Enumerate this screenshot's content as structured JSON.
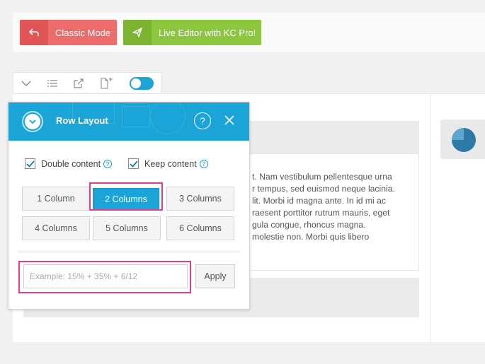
{
  "topbar": {
    "classic_mode_label": "Classic Mode",
    "live_editor_label": "Live Editor with KC Pro!"
  },
  "toolbar": {
    "icons": [
      "chevron-down-icon",
      "list-icon",
      "export-icon",
      "add-page-icon"
    ],
    "toggle_on": true
  },
  "content": {
    "lorem_lines": [
      "t. Nam vestibulum pellentesque urna",
      "r tempus, sed euismod neque lacinia.",
      "lit. Morbi id magna ante. In id mi ac",
      "raesent porttitor rutrum mauris, eget",
      "gula congue, rhoncus magna.",
      "molestie non. Morbi quis libero"
    ]
  },
  "panel": {
    "title": "Row Layout",
    "help_label": "?",
    "double_content_label": "Double content",
    "double_content_checked": true,
    "keep_content_label": "Keep content",
    "keep_content_checked": true,
    "column_options": [
      "1 Column",
      "2 Columns",
      "3 Columns",
      "4 Columns",
      "5 Columns",
      "6 Columns"
    ],
    "selected_option": "2 Columns",
    "custom_placeholder": "Example: 15% + 35% + 6/12",
    "apply_label": "Apply"
  },
  "colors": {
    "accent": "#1aa4d8",
    "classic_red": "#ec6b6b",
    "live_green": "#8cc63f",
    "highlight": "#e03e86"
  }
}
